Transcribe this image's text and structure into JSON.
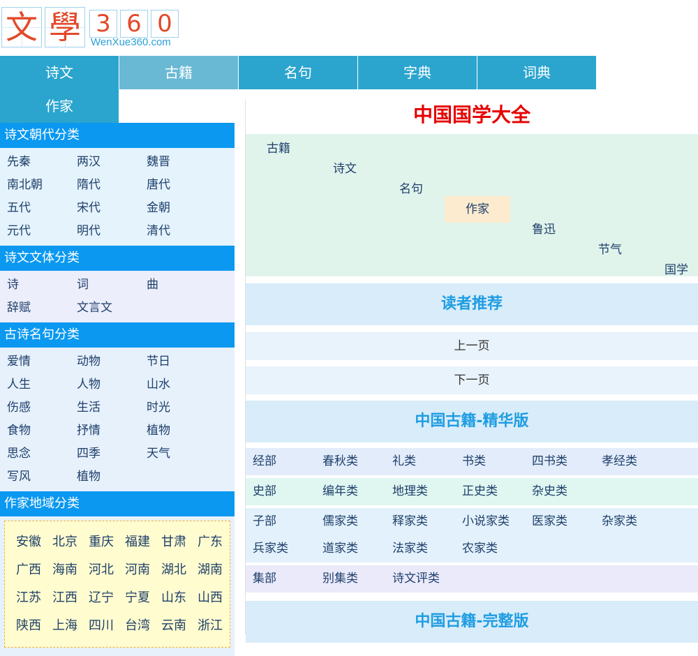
{
  "logo": {
    "chars": [
      "文",
      "學"
    ],
    "digits": [
      "3",
      "6",
      "0"
    ],
    "url": "WenXue360.com"
  },
  "nav": [
    "诗文",
    "古籍",
    "名句",
    "字典",
    "词典",
    "作家"
  ],
  "sidebar": {
    "dynasty": {
      "title": "诗文朝代分类",
      "items": [
        "先秦",
        "两汉",
        "魏晋",
        "南北朝",
        "隋代",
        "唐代",
        "五代",
        "宋代",
        "金朝",
        "元代",
        "明代",
        "清代"
      ]
    },
    "genre": {
      "title": "诗文文体分类",
      "items": [
        "诗",
        "词",
        "曲",
        "辞赋",
        "文言文"
      ]
    },
    "quotes": {
      "title": "古诗名句分类",
      "items": [
        "爱情",
        "动物",
        "节日",
        "人生",
        "人物",
        "山水",
        "伤感",
        "生活",
        "时光",
        "食物",
        "抒情",
        "植物",
        "思念",
        "四季",
        "天气",
        "写风",
        "植物"
      ]
    },
    "region": {
      "title": "作家地域分类",
      "items": [
        "安徽",
        "北京",
        "重庆",
        "福建",
        "甘肃",
        "广东",
        "广西",
        "海南",
        "河北",
        "河南",
        "湖北",
        "湖南",
        "江苏",
        "江西",
        "辽宁",
        "宁夏",
        "山东",
        "山西",
        "陕西",
        "上海",
        "四川",
        "台湾",
        "云南",
        "浙江"
      ]
    }
  },
  "main": {
    "title": "中国国学大全",
    "stairs": [
      "古籍",
      "诗文",
      "名句",
      "作家",
      "鲁迅",
      "节气",
      "国学"
    ],
    "recommend": "读者推荐",
    "prev": "上一页",
    "next": "下一页",
    "essence": "中国古籍-精华版",
    "categories": [
      {
        "label": "经部",
        "items": [
          "春秋类",
          "礼类",
          "书类",
          "四书类",
          "孝经类"
        ],
        "bg": "#e2ecfb"
      },
      {
        "label": "史部",
        "items": [
          "编年类",
          "地理类",
          "正史类",
          "杂史类"
        ],
        "bg": "#dff6f1"
      },
      {
        "label": "子部",
        "items": [
          "儒家类",
          "释家类",
          "小说家类",
          "医家类",
          "杂家类",
          "兵家类",
          "道家类",
          "法家类",
          "农家类"
        ],
        "bg": "#e2f1fb"
      },
      {
        "label": "集部",
        "items": [
          "别集类",
          "诗文评类"
        ],
        "bg": "#eaeafb"
      }
    ],
    "complete": "中国古籍-完整版"
  }
}
